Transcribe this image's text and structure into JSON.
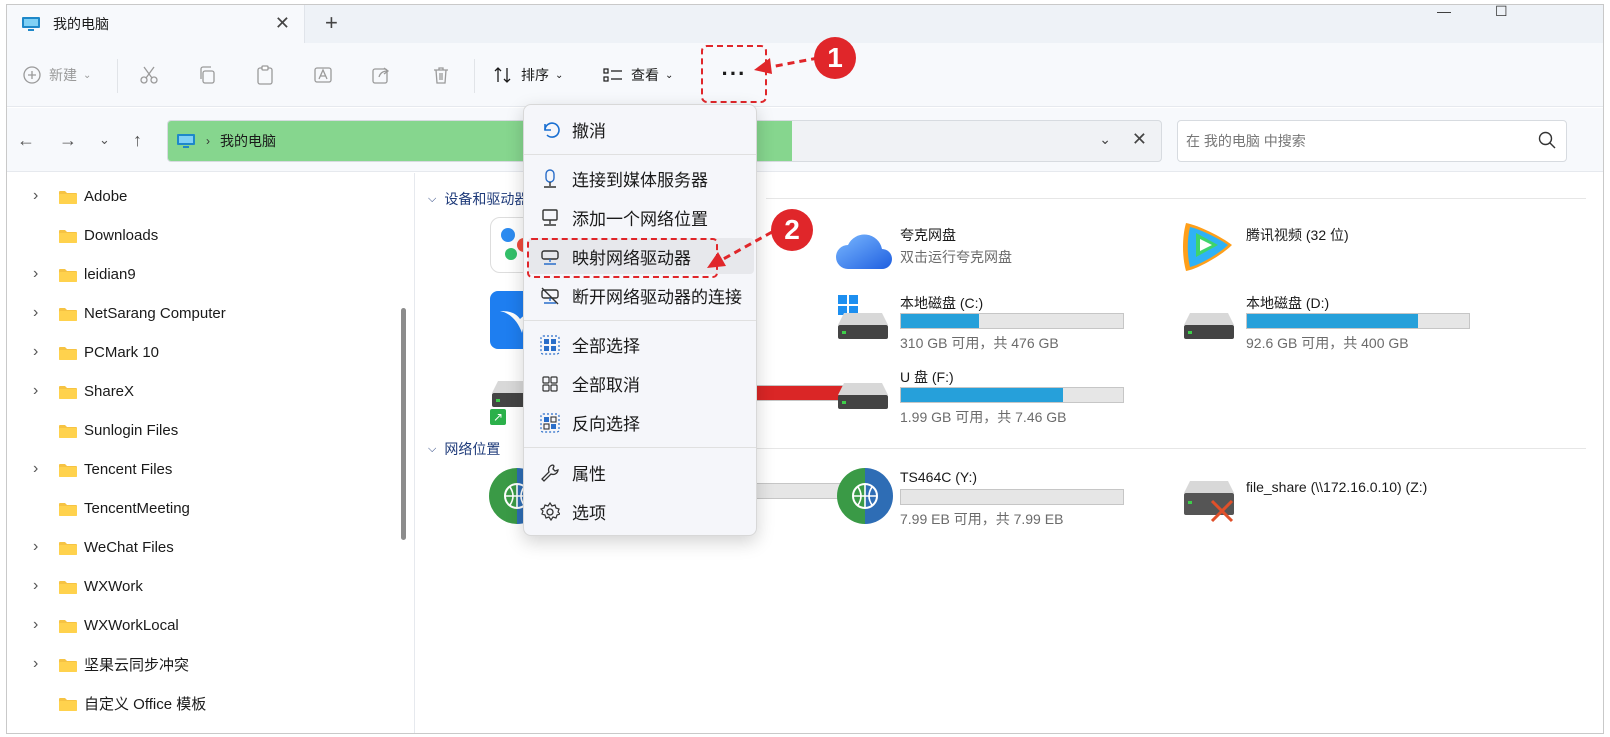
{
  "window": {
    "tab_title": "我的电脑",
    "tab_close": "✕",
    "new_tab": "+",
    "minimize": "—",
    "maximize": "☐"
  },
  "toolbar": {
    "new_label": "新建",
    "sort_label": "排序",
    "view_label": "查看",
    "more_label": "···"
  },
  "nav": {
    "breadcrumb_sep": "›",
    "location": "我的电脑",
    "search_placeholder": "在 我的电脑 中搜索"
  },
  "sidebar": {
    "items": [
      {
        "label": "Adobe",
        "expandable": true
      },
      {
        "label": "Downloads",
        "expandable": false
      },
      {
        "label": "leidian9",
        "expandable": true
      },
      {
        "label": "NetSarang Computer",
        "expandable": true
      },
      {
        "label": "PCMark 10",
        "expandable": true
      },
      {
        "label": "ShareX",
        "expandable": true
      },
      {
        "label": "Sunlogin Files",
        "expandable": false
      },
      {
        "label": "Tencent Files",
        "expandable": true
      },
      {
        "label": "TencentMeeting",
        "expandable": false
      },
      {
        "label": "WeChat Files",
        "expandable": true
      },
      {
        "label": "WXWork",
        "expandable": true
      },
      {
        "label": "WXWorkLocal",
        "expandable": true
      },
      {
        "label": "坚果云同步冲突",
        "expandable": true
      },
      {
        "label": "自定义 Office 模板",
        "expandable": false
      }
    ]
  },
  "main": {
    "group_devices": "设备和驱动器",
    "group_network": "网络位置",
    "drives": [
      {
        "name": "夸克网盘",
        "sub": "双击运行夸克网盘"
      },
      {
        "name": "腾讯视频 (32 位)"
      },
      {
        "name": "本地磁盘 (C:)",
        "sub": "310 GB 可用，共 476 GB",
        "used_fraction": 0.35
      },
      {
        "name": "本地磁盘 (D:)",
        "sub": "92.6 GB 可用，共 400 GB",
        "used_fraction": 0.77
      },
      {
        "name": "U 盘 (F:)",
        "sub": "1.99 GB 可用，共 7.46 GB",
        "used_fraction": 0.73
      },
      {
        "name": "TS464C (Y:)",
        "sub": "7.99 EB 可用，共 7.99 EB",
        "used_fraction": 0.0
      },
      {
        "name": "file_share (\\\\172.16.0.10) (Z:)"
      }
    ]
  },
  "menu": {
    "items": [
      {
        "label": "撤消",
        "icon": "undo-icon"
      },
      {
        "label": "连接到媒体服务器",
        "icon": "media-server-icon"
      },
      {
        "label": "添加一个网络位置",
        "icon": "network-location-icon"
      },
      {
        "label": "映射网络驱动器",
        "icon": "map-drive-icon"
      },
      {
        "label": "断开网络驱动器的连接",
        "icon": "disconnect-drive-icon"
      },
      {
        "label": "全部选择",
        "icon": "select-all-icon"
      },
      {
        "label": "全部取消",
        "icon": "select-none-icon"
      },
      {
        "label": "反向选择",
        "icon": "invert-selection-icon"
      },
      {
        "label": "属性",
        "icon": "properties-icon"
      },
      {
        "label": "选项",
        "icon": "options-icon"
      }
    ]
  },
  "annotations": {
    "step1": "1",
    "step2": "2",
    "color": "#e0262a"
  }
}
